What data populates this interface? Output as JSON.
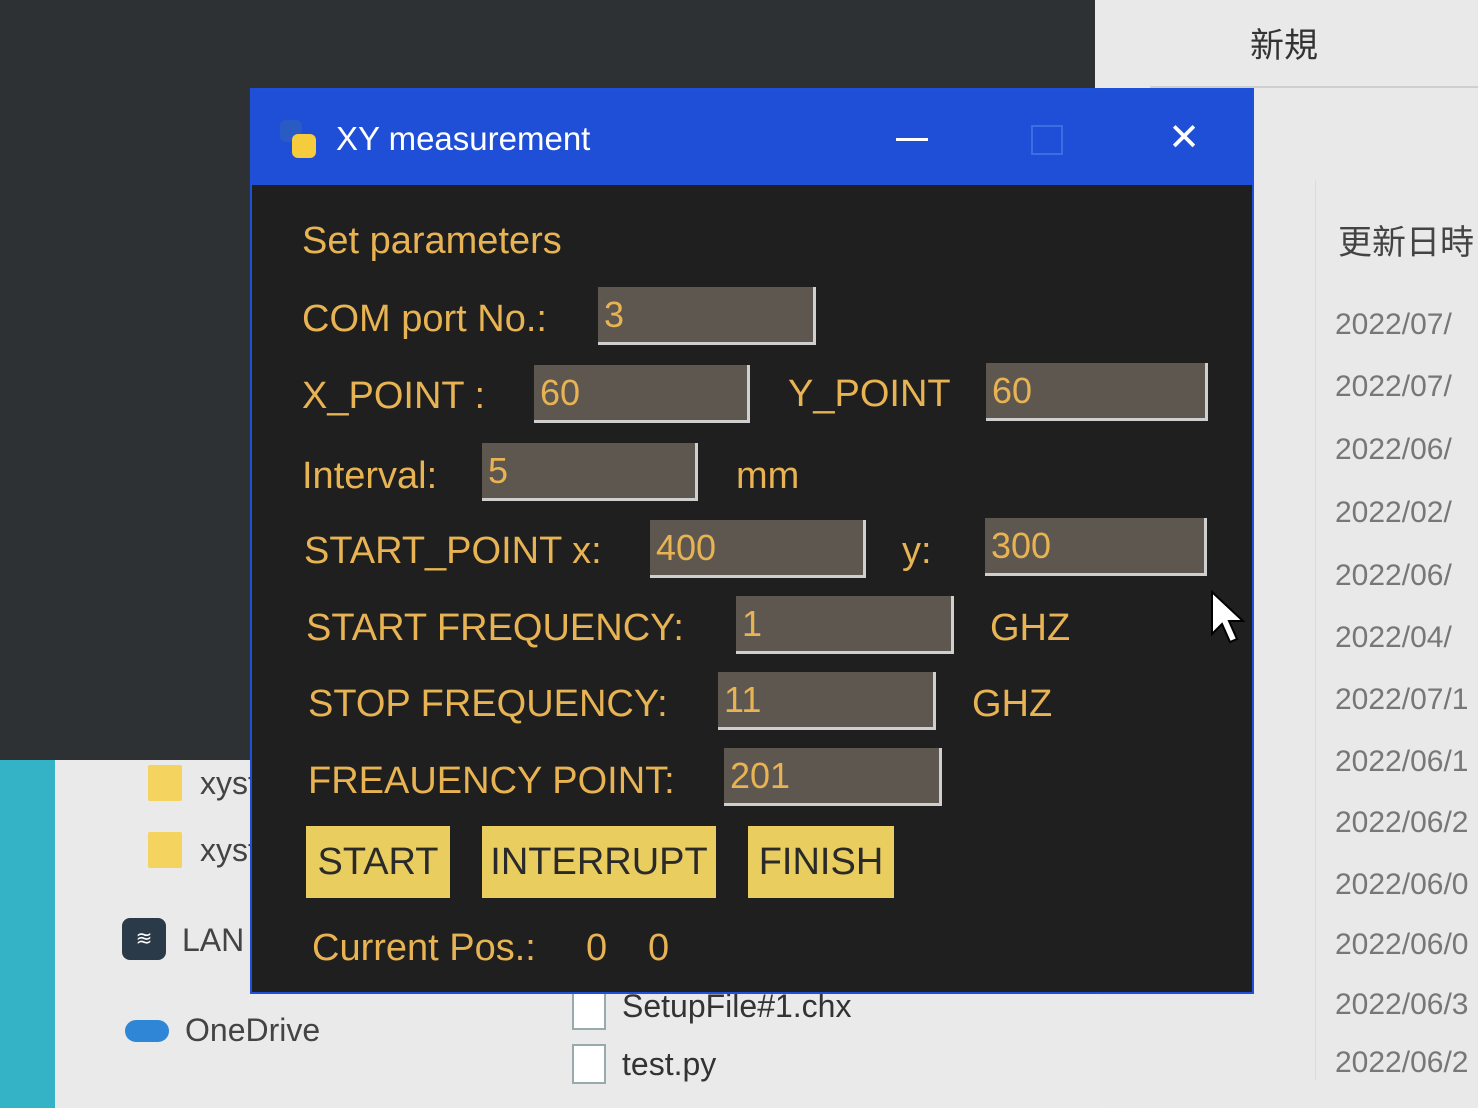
{
  "explorer_right": {
    "new_label": "新規",
    "column_header": "更新日時",
    "dates": [
      "2022/07/",
      "2022/07/",
      "2022/06/",
      "2022/02/",
      "2022/06/",
      "2022/04/",
      "2022/07/1",
      "2022/06/1",
      "2022/06/2",
      "2022/06/0",
      "2022/06/0",
      "2022/06/3",
      "2022/06/2"
    ]
  },
  "explorer_left": {
    "items": [
      "xyst",
      "xyst",
      "LAN",
      "OneDrive"
    ],
    "files": [
      "SetupFile#1.chx",
      "test.py"
    ]
  },
  "window": {
    "title": "XY measurement",
    "section_title": "Set parameters",
    "com_port": {
      "label": "COM port No.:",
      "value": "3"
    },
    "x_point": {
      "label": "X_POINT :",
      "value": "60"
    },
    "y_point": {
      "label": "Y_POINT",
      "value": "60"
    },
    "interval": {
      "label": "Interval:",
      "value": "5",
      "unit": "mm"
    },
    "start_point": {
      "label": "START_POINT x:",
      "x_value": "400",
      "y_label": "y:",
      "y_value": "300"
    },
    "start_frequency": {
      "label": "START FREQUENCY:",
      "value": "1",
      "unit": "GHZ"
    },
    "stop_frequency": {
      "label": "STOP FREQUENCY:",
      "value": "11",
      "unit": "GHZ"
    },
    "frequency_point": {
      "label": "FREAUENCY POINT:",
      "value": "201"
    },
    "buttons": {
      "start": "START",
      "interrupt": "INTERRUPT",
      "finish": "FINISH"
    },
    "current_pos": {
      "label": "Current Pos.:",
      "x": "0",
      "y": "0"
    }
  },
  "colors": {
    "titlebar": "#1f4fd6",
    "window_bg": "#1f1f1f",
    "label_text": "#e8b352",
    "button_bg": "#e9cd5e",
    "field_bg": "#5d5750"
  }
}
